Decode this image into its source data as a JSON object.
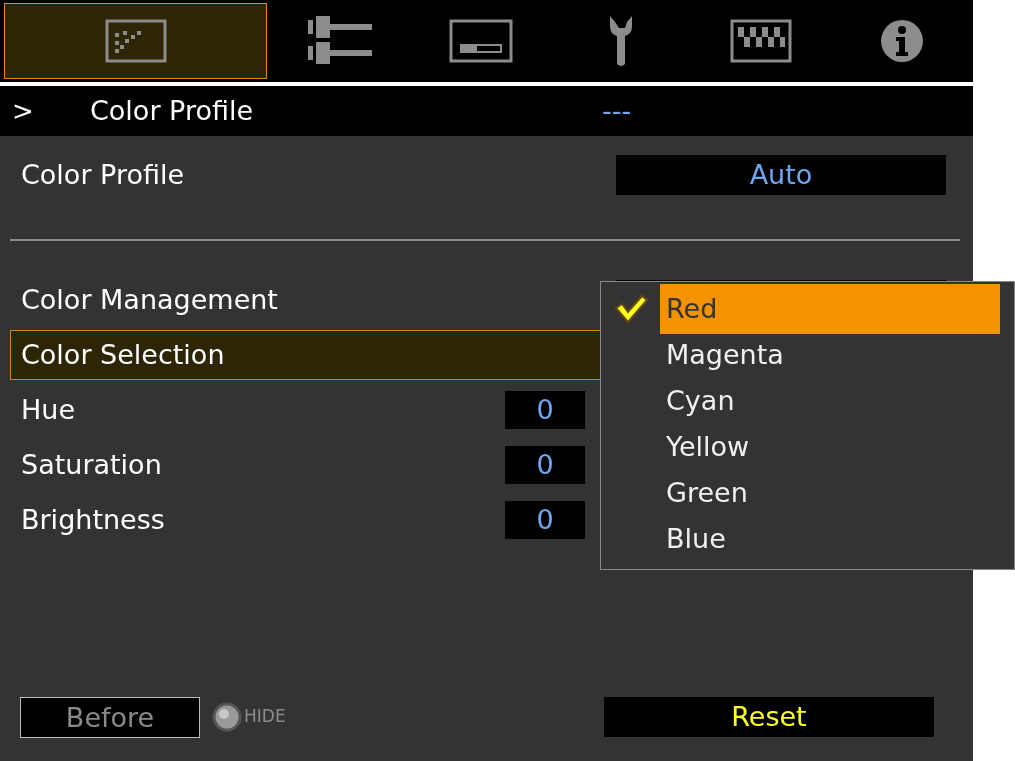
{
  "tabs": [
    {
      "selected": true
    },
    {
      "selected": false
    },
    {
      "selected": false
    },
    {
      "selected": false
    },
    {
      "selected": false
    },
    {
      "selected": false
    }
  ],
  "header": {
    "marker": ">",
    "title": "Color Profile",
    "value": "---"
  },
  "rows": [
    {
      "kind": "select",
      "label": "Color Profile",
      "value": "Auto",
      "selected": false
    },
    {
      "kind": "divider"
    },
    {
      "kind": "select",
      "label": "Color Management",
      "selected": false
    },
    {
      "kind": "plain",
      "label": "Color Selection",
      "selected": true
    },
    {
      "kind": "number",
      "label": "Hue",
      "value": "0",
      "selected": false
    },
    {
      "kind": "number",
      "label": "Saturation",
      "value": "0",
      "selected": false
    },
    {
      "kind": "number",
      "label": "Brightness",
      "value": "0",
      "selected": false
    }
  ],
  "dropdown": [
    {
      "label": "Red",
      "checked": true,
      "selected": true
    },
    {
      "label": "Magenta",
      "checked": false,
      "selected": false
    },
    {
      "label": "Cyan",
      "checked": false,
      "selected": false
    },
    {
      "label": "Yellow",
      "checked": false,
      "selected": false
    },
    {
      "label": "Green",
      "checked": false,
      "selected": false
    },
    {
      "label": "Blue",
      "checked": false,
      "selected": false
    }
  ],
  "footer": {
    "before": "Before",
    "hide": "HIDE",
    "reset": "Reset"
  }
}
